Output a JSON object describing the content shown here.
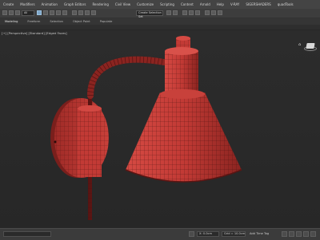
{
  "menu": {
    "items": [
      "Create",
      "Modifiers",
      "Animation",
      "Graph Editors",
      "Rendering",
      "Civil View",
      "Customize",
      "Scripting",
      "Content",
      "Arnold",
      "Help",
      "V-RAY",
      "SIGERSHADERS",
      "quadTools"
    ]
  },
  "toolbar": {
    "selection_filter": "All",
    "named_selection": "Create Selection Set"
  },
  "ribbon": {
    "tabs": [
      "Modeling",
      "Freeform",
      "Selection",
      "Object Paint",
      "Populate"
    ]
  },
  "viewport": {
    "label": "[+] [Perspective] [Standard] [Edged Faces]",
    "model": "wall sconce lamp",
    "colors": {
      "mesh": "#c23a35",
      "mesh_dark": "#7a1f1c",
      "wire": "#3a0d0c",
      "background": "#2b2b2b"
    }
  },
  "statusbar": {
    "coord_text": "X: 0.0cm",
    "grid_text": "Grid = 10.0cm",
    "add_time_tag": "Add Time Tag"
  },
  "icons": [
    "select-icon",
    "move-icon",
    "rotate-icon",
    "scale-icon",
    "snap-icon",
    "render-icon",
    "home-icon",
    "viewcube-icon",
    "play-icon",
    "key-icon"
  ]
}
